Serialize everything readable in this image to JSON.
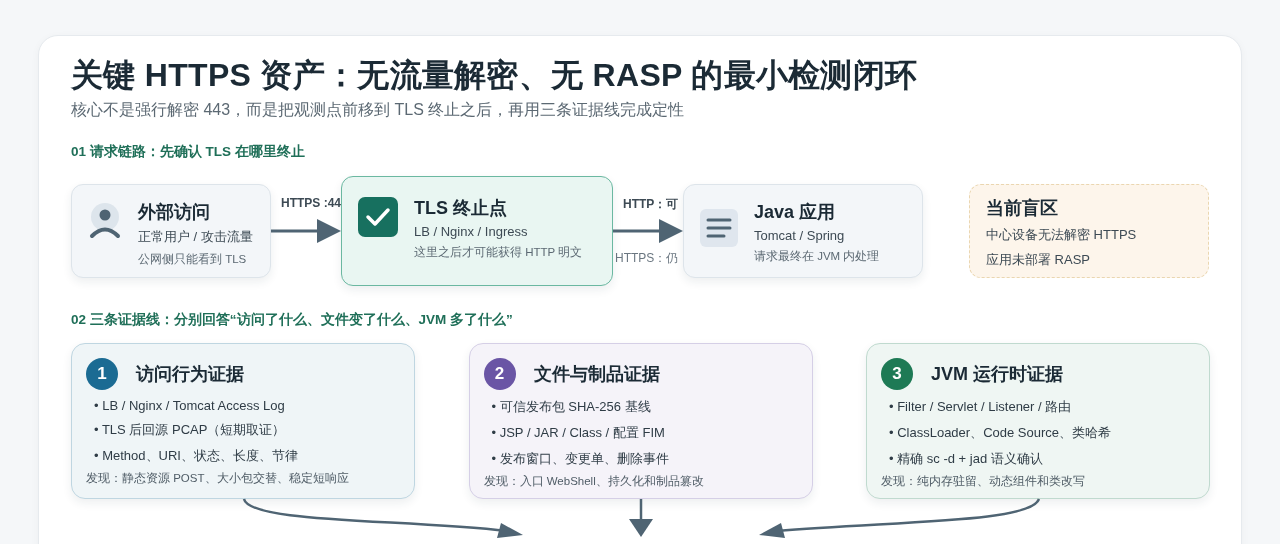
{
  "title": "关键 HTTPS 资产：无流量解密、无 RASP 的最小检测闭环",
  "subtitle": "核心不是强行解密 443，而是把观测点前移到 TLS 终止之后，再用三条证据线完成定性",
  "request_chain": {
    "heading": "01 请求链路：先确认 TLS 在哪里终止",
    "items": [
      {
        "kind": "source",
        "title": "外部访问",
        "subtitle": "正常用户 / 攻击流量",
        "note": "公网侧只能看到 TLS"
      },
      {
        "kind": "arrow",
        "label_above": "HTTPS :44"
      },
      {
        "kind": "terminator",
        "title": "TLS 终止点",
        "subtitle": "LB / Nginx / Ingress",
        "note": "这里之后才可能获得 HTTP 明文"
      },
      {
        "kind": "arrow",
        "label_above": "HTTP：可",
        "label_below": "HTTPS：仍"
      },
      {
        "kind": "app",
        "title": "Java 应用",
        "subtitle": "Tomcat / Spring",
        "note": "请求最终在 JVM 内处理"
      },
      {
        "kind": "blind",
        "title": "当前盲区",
        "lines": [
          "中心设备无法解密 HTTPS",
          "应用未部署 RASP"
        ]
      }
    ]
  },
  "evidence": {
    "heading": "02 三条证据线：分别回答“访问了什么、文件变了什么、JVM 多了什么”",
    "cards": [
      {
        "number": "1",
        "title": "访问行为证据",
        "color": "#1b6b93",
        "bullets": [
          "• LB / Nginx / Tomcat Access Log",
          "• TLS 后回源 PCAP（短期取证）",
          "• Method、URI、状态、长度、节律"
        ],
        "finding": "发现：静态资源 POST、大小包交替、稳定短响应"
      },
      {
        "number": "2",
        "title": "文件与制品证据",
        "color": "#6a55a5",
        "bullets": [
          "• 可信发布包 SHA-256 基线",
          "• JSP / JAR / Class / 配置 FIM",
          "• 发布窗口、变更单、删除事件"
        ],
        "finding": "发现：入口 WebShell、持久化和制品篡改"
      },
      {
        "number": "3",
        "title": "JVM 运行时证据",
        "color": "#1e7a55",
        "bullets": [
          "• Filter / Servlet / Listener / 路由",
          "• ClassLoader、Code Source、类哈希",
          "• 精确 sc -d + jad 语义确认"
        ],
        "finding": "发现：纯内存驻留、动态组件和类改写"
      }
    ]
  }
}
